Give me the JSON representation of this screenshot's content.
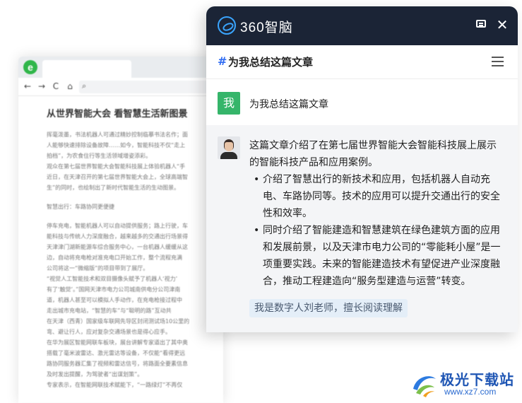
{
  "browser": {
    "nav": {
      "back": "←",
      "forward": "→",
      "refresh": "C",
      "home": "⌂",
      "search": "🔍"
    },
    "article": {
      "title": "从世界智能大会 看智慧生活新图景",
      "lines": [
        "挥毫泼墨，书法机器人可通过精妙控制临摹书法名作；面",
        "人能够快速排除设备故障……如今，智能科技不仅“走上",
        "拍档”，为农食住行等生活领域增姿添彩。",
        "观众在第七届世界智能大会智能科技展上体验机器人“手",
        "近日，在天津召开的第七届世界智能大会上，全球高端智",
        "生”的同时，也绘制出了新时代智能生活的生动图景。",
        "",
        "智慧出行：车路协同更便捷",
        "",
        "停车充电，智能机器人可以自动提供服务；路上行驶，车",
        "能科技与传统人力深度融合，越来越多的交通出行场景得",
        "天津津门湖新能源车综合服务中心，一台机器人缓缓从这",
        "边，自动将充电枪对准充电口开始工作，整个流程充满",
        "公司将这一“微缩版”的项目带到了展厅。",
        "“视觉人工智能技术和双目摄像头赋予了机器人‘视力’",
        "有了‘触觉’。”国网天津市电力公司城南供电分公司津南",
        "道，机器人甚至可以模拟人手动作，在充电枪接过程中",
        "走出城市充电站，“智慧的车”与“聪明的路”互动共",
        "在天津（西青）国家级车联网先导区封闭测试场10公里的",
        "弯、避让行人，应对复杂交通场景也是得心应手。",
        "在华为展区智能网联车板块，展台讲解专家道出了其中奥",
        "搭载了毫米波雷达、激光雷达等设备，不仅能“看得更远",
        "路协同服务器汇集了视频和雷达信号，将路面全要素信息",
        "及时发出提醒，为驾驶者“出谋划策”。",
        "专家表示，在智能网联技术赋能下，“一路绿灯”不再仅"
      ]
    }
  },
  "panel": {
    "brand": "360智脑",
    "subheader_hash": "#",
    "subheader_title": "为我总结这篇文章",
    "user": {
      "avatar_text": "我",
      "message": "为我总结这篇文章"
    },
    "bot": {
      "intro": "这篇文章介绍了在第七届世界智能大会智能科技展上展示的智能科技产品和应用案例。",
      "points": [
        "介绍了智慧出行的新技术和应用，包括机器人自动充电、车路协同等。技术的应用可以提升交通出行的安全性和效率。",
        "同时介绍了智能建造和智慧建筑在绿色建筑方面的应用和发展前景，以及天津市电力公司的“零能耗小屋”是一项重要实践。未来的智能建造技术有望促进产业深度融合，推动工程建造向“服务型建造与运营”转变。"
      ],
      "footer": "我是数字人刘老师，擅长阅读理解"
    }
  },
  "watermark": {
    "name": "极光下载站",
    "url": "www.xz7.com"
  },
  "colors": {
    "header_bg": "#1b2436",
    "accent_blue": "#2e6bf3",
    "user_avatar_green": "#35b56a"
  }
}
